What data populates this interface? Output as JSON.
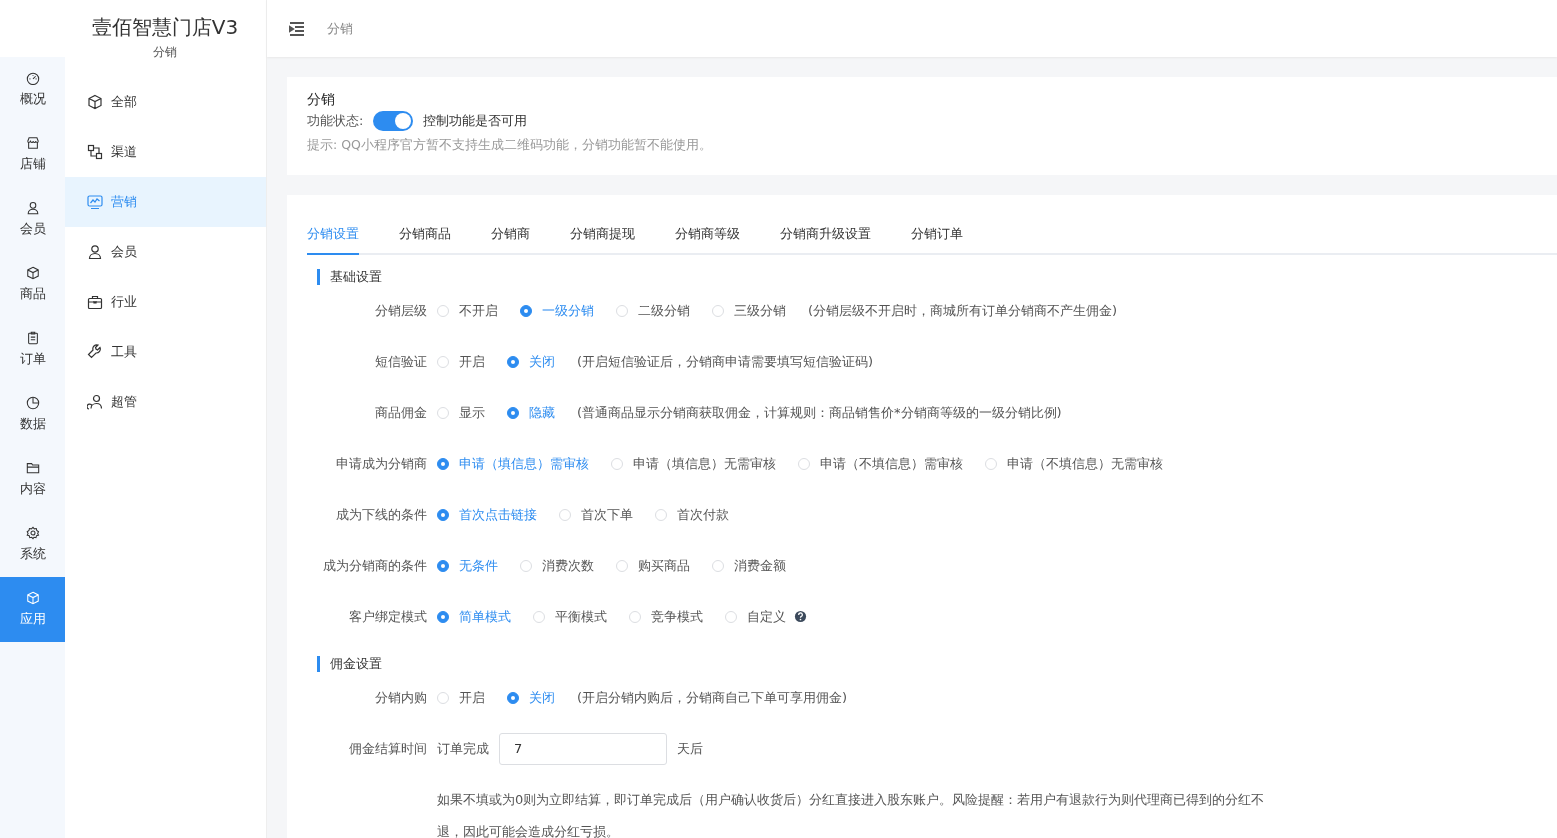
{
  "brand": {
    "title": "壹佰智慧门店V3",
    "subtitle": "分销"
  },
  "rail": [
    {
      "label": "概况",
      "selected": false
    },
    {
      "label": "店铺",
      "selected": false
    },
    {
      "label": "会员",
      "selected": false
    },
    {
      "label": "商品",
      "selected": false
    },
    {
      "label": "订单",
      "selected": false
    },
    {
      "label": "数据",
      "selected": false
    },
    {
      "label": "内容",
      "selected": false
    },
    {
      "label": "系统",
      "selected": false
    },
    {
      "label": "应用",
      "selected": true
    }
  ],
  "submenu": [
    {
      "label": "全部",
      "selected": false
    },
    {
      "label": "渠道",
      "selected": false
    },
    {
      "label": "营销",
      "selected": true
    },
    {
      "label": "会员",
      "selected": false
    },
    {
      "label": "行业",
      "selected": false
    },
    {
      "label": "工具",
      "selected": false
    },
    {
      "label": "超管",
      "selected": false
    }
  ],
  "breadcrumb": "分销",
  "plugin": {
    "title": "分销",
    "status_label": "功能状态:",
    "on": true,
    "status_note": "控制功能是否可用",
    "hint": "提示: QQ小程序官方暂不支持生成二维码功能，分销功能暂不能使用。"
  },
  "tabs": [
    {
      "label": "分销设置",
      "selected": true
    },
    {
      "label": "分销商品",
      "selected": false
    },
    {
      "label": "分销商",
      "selected": false
    },
    {
      "label": "分销商提现",
      "selected": false
    },
    {
      "label": "分销商等级",
      "selected": false
    },
    {
      "label": "分销商升级设置",
      "selected": false
    },
    {
      "label": "分销订单",
      "selected": false
    }
  ],
  "sections": [
    {
      "title": "基础设置",
      "rows": [
        {
          "kind": "radio",
          "label": "分销层级",
          "options": [
            {
              "label": "不开启",
              "selected": false
            },
            {
              "label": "一级分销",
              "selected": true
            },
            {
              "label": "二级分销",
              "selected": false
            },
            {
              "label": "三级分销",
              "selected": false
            }
          ],
          "note": "(分销层级不开启时，商城所有订单分销商不产生佣金)"
        },
        {
          "kind": "radio",
          "label": "短信验证",
          "options": [
            {
              "label": "开启",
              "selected": false
            },
            {
              "label": "关闭",
              "selected": true
            }
          ],
          "note": "(开启短信验证后，分销商申请需要填写短信验证码)"
        },
        {
          "kind": "radio",
          "label": "商品佣金",
          "options": [
            {
              "label": "显示",
              "selected": false
            },
            {
              "label": "隐藏",
              "selected": true
            }
          ],
          "note": "(普通商品显示分销商获取佣金，计算规则：商品销售价*分销商等级的一级分销比例)"
        },
        {
          "kind": "radio",
          "label": "申请成为分销商",
          "options": [
            {
              "label": "申请（填信息）需审核",
              "selected": true
            },
            {
              "label": "申请（填信息）无需审核",
              "selected": false
            },
            {
              "label": "申请（不填信息）需审核",
              "selected": false
            },
            {
              "label": "申请（不填信息）无需审核",
              "selected": false
            }
          ]
        },
        {
          "kind": "radio",
          "label": "成为下线的条件",
          "options": [
            {
              "label": "首次点击链接",
              "selected": true
            },
            {
              "label": "首次下单",
              "selected": false
            },
            {
              "label": "首次付款",
              "selected": false
            }
          ]
        },
        {
          "kind": "radio",
          "label": "成为分销商的条件",
          "options": [
            {
              "label": "无条件",
              "selected": true
            },
            {
              "label": "消费次数",
              "selected": false
            },
            {
              "label": "购买商品",
              "selected": false
            },
            {
              "label": "消费金额",
              "selected": false
            }
          ]
        },
        {
          "kind": "radio",
          "label": "客户绑定模式",
          "options": [
            {
              "label": "简单模式",
              "selected": true
            },
            {
              "label": "平衡模式",
              "selected": false
            },
            {
              "label": "竞争模式",
              "selected": false
            },
            {
              "label": "自定义",
              "selected": false
            }
          ],
          "help": true
        }
      ]
    },
    {
      "title": "佣金设置",
      "rows": [
        {
          "kind": "radio",
          "label": "分销内购",
          "options": [
            {
              "label": "开启",
              "selected": false
            },
            {
              "label": "关闭",
              "selected": true
            }
          ],
          "note": "(开启分销内购后，分销商自己下单可享用佣金)"
        },
        {
          "kind": "input",
          "label": "佣金结算时间",
          "prefix": "订单完成",
          "value": "7",
          "suffix": "天后",
          "description": "如果不填或为0则为立即结算，即订单完成后（用户确认收货后）分红直接进入股东账户。风险提醒：若用户有退款行为则代理商已得到的分红不退，因此可能会造成分红亏损。"
        }
      ]
    }
  ]
}
